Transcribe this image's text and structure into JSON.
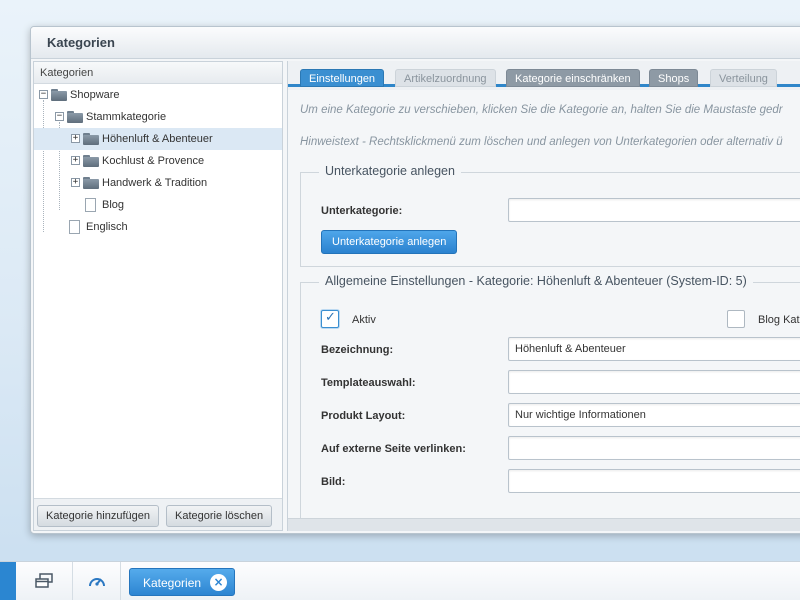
{
  "window": {
    "title": "Kategorien"
  },
  "left_panel": {
    "header": "Kategorien",
    "tree": [
      {
        "label": "Shopware",
        "type": "folder",
        "toggle": "−"
      },
      {
        "label": "Stammkategorie",
        "type": "folder",
        "toggle": "−"
      },
      {
        "label": "Höhenluft & Abenteuer",
        "type": "folder",
        "toggle": "+",
        "selected": true
      },
      {
        "label": "Kochlust & Provence",
        "type": "folder",
        "toggle": "+"
      },
      {
        "label": "Handwerk & Tradition",
        "type": "folder",
        "toggle": "+"
      },
      {
        "label": "Blog",
        "type": "page"
      },
      {
        "label": "Englisch",
        "type": "page"
      }
    ],
    "buttons": {
      "add": "Kategorie hinzufügen",
      "delete": "Kategorie löschen"
    }
  },
  "tabs": [
    {
      "label": "Einstellungen",
      "state": "active"
    },
    {
      "label": "Artikelzuordnung",
      "state": "light"
    },
    {
      "label": "Kategorie einschränken",
      "state": "dark"
    },
    {
      "label": "Shops",
      "state": "dark"
    },
    {
      "label": "Verteilung",
      "state": "light"
    }
  ],
  "hints": {
    "move": "Um eine Kategorie zu verschieben, klicken Sie die Kategorie an, halten Sie die Maustaste gedr",
    "context": "Hinweistext - Rechtsklickmenü zum löschen und anlegen von Unterkategorien oder alternativ ü"
  },
  "subcategory": {
    "legend": "Unterkategorie anlegen",
    "field_label": "Unterkategorie:",
    "value": "",
    "button": "Unterkategorie anlegen"
  },
  "general": {
    "legend": "Allgemeine Einstellungen - Kategorie: Höhenluft & Abenteuer (System-ID: 5)",
    "aktiv_label": "Aktiv",
    "aktiv_checked": true,
    "blog_label": "Blog Kate",
    "blog_checked": false,
    "fields": {
      "bezeichnung": {
        "label": "Bezeichnung:",
        "value": "Höhenluft & Abenteuer"
      },
      "template": {
        "label": "Templateauswahl:",
        "value": ""
      },
      "layout": {
        "label": "Produkt Layout:",
        "value": "Nur wichtige Informationen"
      },
      "extern": {
        "label": "Auf externe Seite verlinken:",
        "value": ""
      },
      "bild": {
        "label": "Bild:",
        "value": ""
      }
    }
  },
  "taskbar": {
    "task_label": "Kategorien",
    "icons": [
      "windows-icon",
      "dashboard-icon"
    ]
  },
  "colors": {
    "accent": "#2f86c9",
    "tab_dark": "#8e9aa5",
    "selected_row": "#dbe8f4"
  }
}
